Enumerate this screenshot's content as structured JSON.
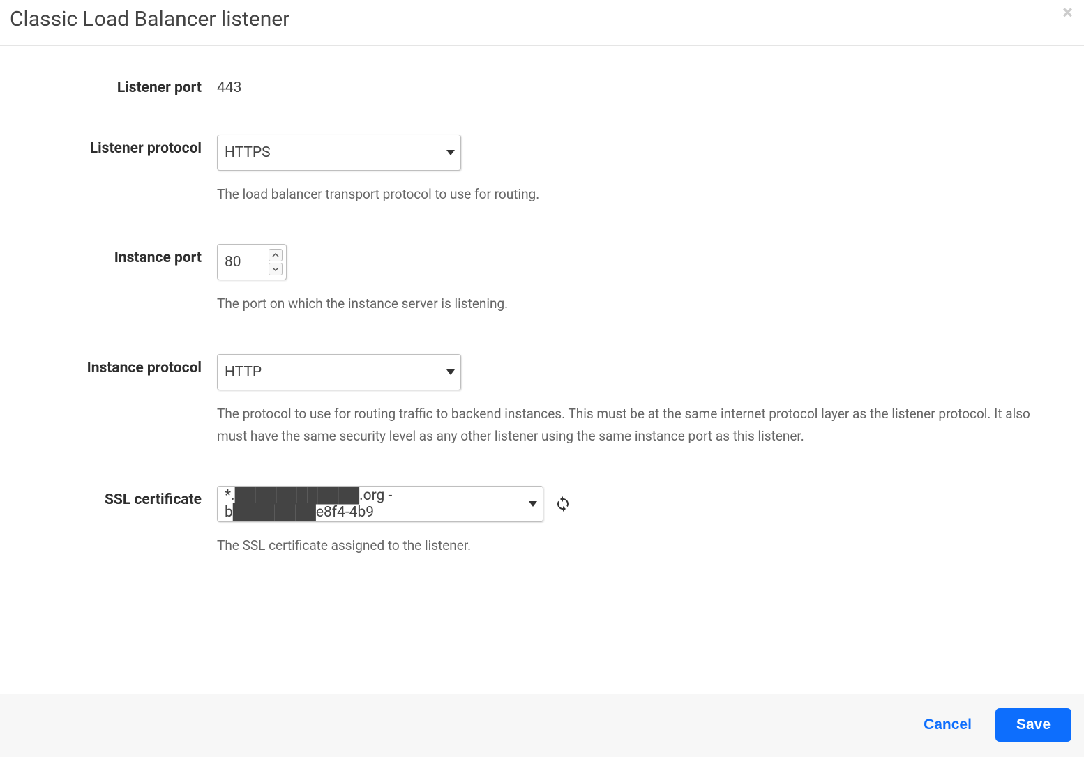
{
  "header": {
    "title": "Classic Load Balancer listener",
    "close_symbol": "×"
  },
  "form": {
    "listener_port": {
      "label": "Listener port",
      "value": "443"
    },
    "listener_protocol": {
      "label": "Listener protocol",
      "value": "HTTPS",
      "help": "The load balancer transport protocol to use for routing."
    },
    "instance_port": {
      "label": "Instance port",
      "value": "80",
      "help": "The port on which the instance server is listening."
    },
    "instance_protocol": {
      "label": "Instance protocol",
      "value": "HTTP",
      "help": "The protocol to use for routing traffic to backend instances. This must be at the same internet protocol layer as the listener protocol. It also must have the same security level as any other listener using the same instance port as this listener."
    },
    "ssl_certificate": {
      "label": "SSL certificate",
      "value": "*.████████████.org - b████████e8f4-4b9",
      "help": "The SSL certificate assigned to the listener."
    }
  },
  "footer": {
    "cancel_label": "Cancel",
    "save_label": "Save"
  },
  "icons": {
    "refresh": "refresh-icon",
    "close": "close-icon"
  }
}
